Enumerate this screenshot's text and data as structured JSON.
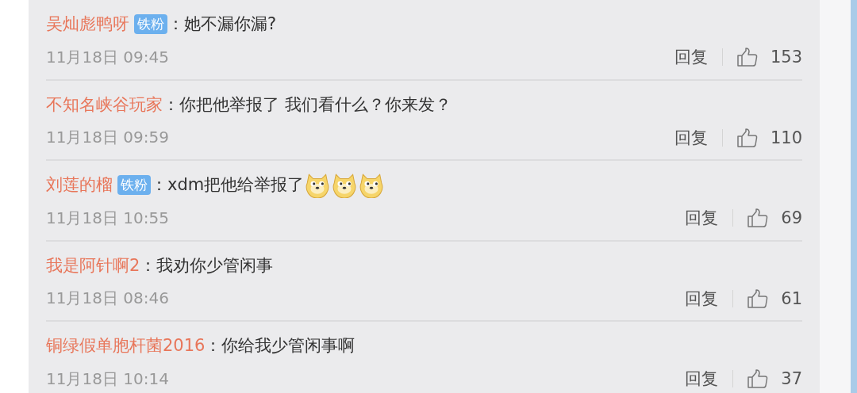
{
  "comments": [
    {
      "author": "吴灿彪鸭呀",
      "badge": "铁粉",
      "separator": "：",
      "text": "她不漏你漏?",
      "time": "11月18日 09:45",
      "reply": "回复",
      "likes": "153"
    },
    {
      "author": "不知名峡谷玩家",
      "separator": "：",
      "text": "你把他举报了 我们看什么？你来发？",
      "time": "11月18日 09:59",
      "reply": "回复",
      "likes": "110"
    },
    {
      "author": "刘莲的榴",
      "badge": "铁粉",
      "separator": "：",
      "text": "xdm把他给举报了",
      "emojis": [
        {
          "kind": "doge"
        },
        {
          "kind": "doge"
        },
        {
          "kind": "doge"
        }
      ],
      "time": "11月18日 10:55",
      "reply": "回复",
      "likes": "69"
    },
    {
      "author": "我是阿针啊2",
      "separator": "：",
      "text": "我劝你少管闲事",
      "time": "11月18日 08:46",
      "reply": "回复",
      "likes": "61"
    },
    {
      "author": "铜绿假单胞杆菌2016",
      "separator": "：",
      "text": "你给我少管闲事啊",
      "time": "11月18日 10:14",
      "reply": "回复",
      "likes": "37"
    }
  ]
}
